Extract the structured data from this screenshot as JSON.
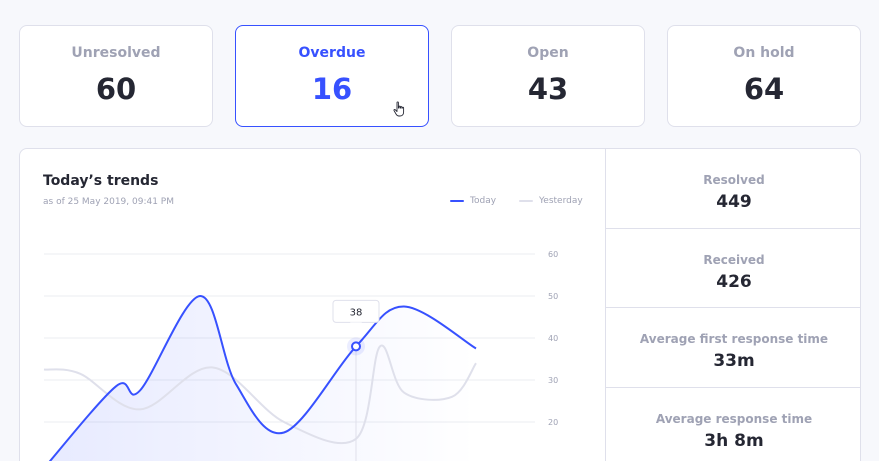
{
  "summary_cards": [
    {
      "label": "Unresolved",
      "value": "60"
    },
    {
      "label": "Overdue",
      "value": "16"
    },
    {
      "label": "Open",
      "value": "43"
    },
    {
      "label": "On hold",
      "value": "64"
    }
  ],
  "trends": {
    "title": "Today’s trends",
    "subtitle": "as of 25 May 2019, 09:41 PM",
    "legend": {
      "today": "Today",
      "yesterday": "Yesterday"
    },
    "tooltip_value": "38"
  },
  "stats": [
    {
      "label": "Resolved",
      "value": "449"
    },
    {
      "label": "Received",
      "value": "426"
    },
    {
      "label": "Average first response time",
      "value": "33m"
    },
    {
      "label": "Average response time",
      "value": "3h 8m"
    }
  ],
  "colors": {
    "accent": "#3751ff",
    "muted": "#9fa2b4",
    "yesterday_line": "#dfe0eb",
    "border": "#dfe0eb"
  },
  "chart_data": {
    "type": "line",
    "y_ticks": [
      "60",
      "50",
      "40",
      "30",
      "20"
    ],
    "ylim": [
      10,
      62
    ],
    "grid": true,
    "legend_position": "top-right",
    "series": [
      {
        "name": "Today",
        "color": "#3751ff",
        "points": [
          [
            0,
            9
          ],
          [
            3,
            28.5
          ],
          [
            4,
            27.5
          ],
          [
            6.5,
            50
          ],
          [
            8,
            29
          ],
          [
            10,
            17.5
          ],
          [
            13,
            38
          ],
          [
            15,
            47.5
          ],
          [
            18,
            37.5
          ]
        ]
      },
      {
        "name": "Yesterday",
        "color": "#dfe0eb",
        "points": [
          [
            0,
            32.5
          ],
          [
            1.5,
            31.5
          ],
          [
            4,
            23
          ],
          [
            7,
            33
          ],
          [
            10,
            20
          ],
          [
            13,
            16
          ],
          [
            14,
            38
          ],
          [
            15,
            27
          ],
          [
            17,
            26
          ],
          [
            18,
            34
          ]
        ]
      }
    ],
    "highlight": {
      "x": 13,
      "y": 38,
      "label": "38"
    }
  }
}
